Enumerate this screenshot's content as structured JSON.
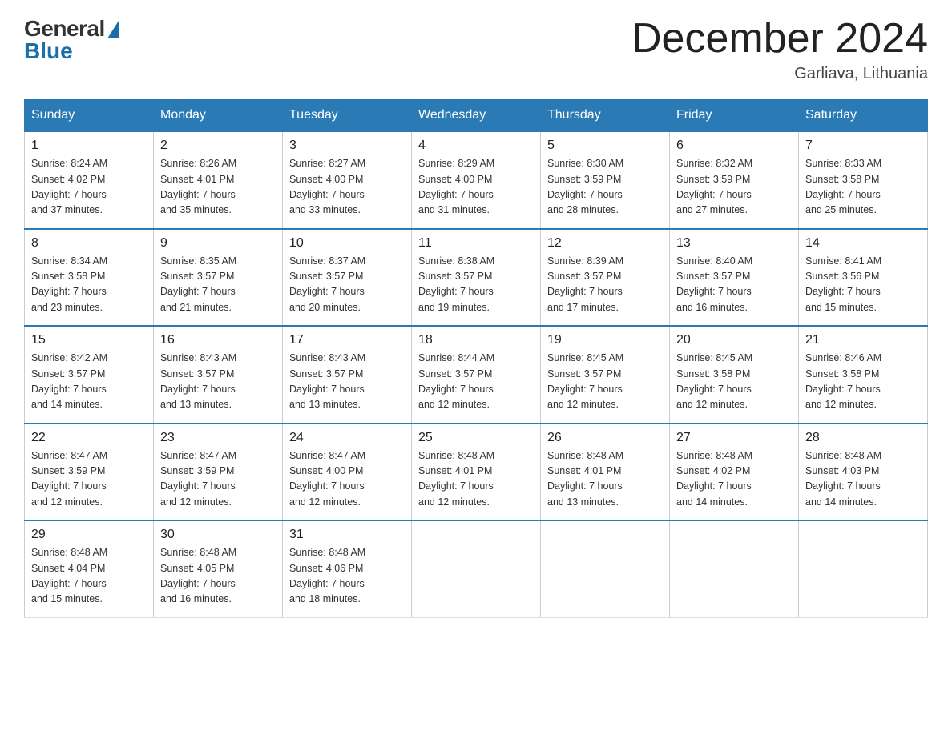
{
  "header": {
    "logo_general": "General",
    "logo_blue": "Blue",
    "month_title": "December 2024",
    "location": "Garliava, Lithuania"
  },
  "weekdays": [
    "Sunday",
    "Monday",
    "Tuesday",
    "Wednesday",
    "Thursday",
    "Friday",
    "Saturday"
  ],
  "weeks": [
    [
      {
        "day": "1",
        "sunrise": "8:24 AM",
        "sunset": "4:02 PM",
        "daylight": "7 hours and 37 minutes."
      },
      {
        "day": "2",
        "sunrise": "8:26 AM",
        "sunset": "4:01 PM",
        "daylight": "7 hours and 35 minutes."
      },
      {
        "day": "3",
        "sunrise": "8:27 AM",
        "sunset": "4:00 PM",
        "daylight": "7 hours and 33 minutes."
      },
      {
        "day": "4",
        "sunrise": "8:29 AM",
        "sunset": "4:00 PM",
        "daylight": "7 hours and 31 minutes."
      },
      {
        "day": "5",
        "sunrise": "8:30 AM",
        "sunset": "3:59 PM",
        "daylight": "7 hours and 28 minutes."
      },
      {
        "day": "6",
        "sunrise": "8:32 AM",
        "sunset": "3:59 PM",
        "daylight": "7 hours and 27 minutes."
      },
      {
        "day": "7",
        "sunrise": "8:33 AM",
        "sunset": "3:58 PM",
        "daylight": "7 hours and 25 minutes."
      }
    ],
    [
      {
        "day": "8",
        "sunrise": "8:34 AM",
        "sunset": "3:58 PM",
        "daylight": "7 hours and 23 minutes."
      },
      {
        "day": "9",
        "sunrise": "8:35 AM",
        "sunset": "3:57 PM",
        "daylight": "7 hours and 21 minutes."
      },
      {
        "day": "10",
        "sunrise": "8:37 AM",
        "sunset": "3:57 PM",
        "daylight": "7 hours and 20 minutes."
      },
      {
        "day": "11",
        "sunrise": "8:38 AM",
        "sunset": "3:57 PM",
        "daylight": "7 hours and 19 minutes."
      },
      {
        "day": "12",
        "sunrise": "8:39 AM",
        "sunset": "3:57 PM",
        "daylight": "7 hours and 17 minutes."
      },
      {
        "day": "13",
        "sunrise": "8:40 AM",
        "sunset": "3:57 PM",
        "daylight": "7 hours and 16 minutes."
      },
      {
        "day": "14",
        "sunrise": "8:41 AM",
        "sunset": "3:56 PM",
        "daylight": "7 hours and 15 minutes."
      }
    ],
    [
      {
        "day": "15",
        "sunrise": "8:42 AM",
        "sunset": "3:57 PM",
        "daylight": "7 hours and 14 minutes."
      },
      {
        "day": "16",
        "sunrise": "8:43 AM",
        "sunset": "3:57 PM",
        "daylight": "7 hours and 13 minutes."
      },
      {
        "day": "17",
        "sunrise": "8:43 AM",
        "sunset": "3:57 PM",
        "daylight": "7 hours and 13 minutes."
      },
      {
        "day": "18",
        "sunrise": "8:44 AM",
        "sunset": "3:57 PM",
        "daylight": "7 hours and 12 minutes."
      },
      {
        "day": "19",
        "sunrise": "8:45 AM",
        "sunset": "3:57 PM",
        "daylight": "7 hours and 12 minutes."
      },
      {
        "day": "20",
        "sunrise": "8:45 AM",
        "sunset": "3:58 PM",
        "daylight": "7 hours and 12 minutes."
      },
      {
        "day": "21",
        "sunrise": "8:46 AM",
        "sunset": "3:58 PM",
        "daylight": "7 hours and 12 minutes."
      }
    ],
    [
      {
        "day": "22",
        "sunrise": "8:47 AM",
        "sunset": "3:59 PM",
        "daylight": "7 hours and 12 minutes."
      },
      {
        "day": "23",
        "sunrise": "8:47 AM",
        "sunset": "3:59 PM",
        "daylight": "7 hours and 12 minutes."
      },
      {
        "day": "24",
        "sunrise": "8:47 AM",
        "sunset": "4:00 PM",
        "daylight": "7 hours and 12 minutes."
      },
      {
        "day": "25",
        "sunrise": "8:48 AM",
        "sunset": "4:01 PM",
        "daylight": "7 hours and 12 minutes."
      },
      {
        "day": "26",
        "sunrise": "8:48 AM",
        "sunset": "4:01 PM",
        "daylight": "7 hours and 13 minutes."
      },
      {
        "day": "27",
        "sunrise": "8:48 AM",
        "sunset": "4:02 PM",
        "daylight": "7 hours and 14 minutes."
      },
      {
        "day": "28",
        "sunrise": "8:48 AM",
        "sunset": "4:03 PM",
        "daylight": "7 hours and 14 minutes."
      }
    ],
    [
      {
        "day": "29",
        "sunrise": "8:48 AM",
        "sunset": "4:04 PM",
        "daylight": "7 hours and 15 minutes."
      },
      {
        "day": "30",
        "sunrise": "8:48 AM",
        "sunset": "4:05 PM",
        "daylight": "7 hours and 16 minutes."
      },
      {
        "day": "31",
        "sunrise": "8:48 AM",
        "sunset": "4:06 PM",
        "daylight": "7 hours and 18 minutes."
      },
      null,
      null,
      null,
      null
    ]
  ],
  "labels": {
    "sunrise_prefix": "Sunrise: ",
    "sunset_prefix": "Sunset: ",
    "daylight_prefix": "Daylight: "
  }
}
